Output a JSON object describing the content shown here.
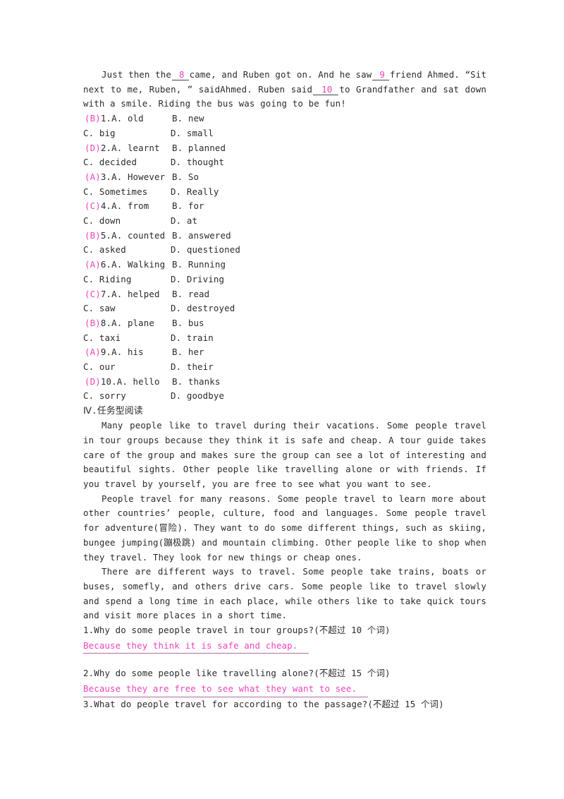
{
  "cloze": {
    "passage_lines": [
      {
        "segments": [
          {
            "type": "text",
            "value": "Just then the "
          },
          {
            "type": "blank",
            "value": "8"
          },
          {
            "type": "text",
            "value": "came, and Ruben got on. And he saw "
          },
          {
            "type": "blank",
            "value": "9"
          },
          {
            "type": "text",
            "value": " friend Ahmed. “Sit next to me, Ruben, ” saidAhmed. Ruben said "
          },
          {
            "type": "blank",
            "value": "10"
          },
          {
            "type": "text",
            "value": " to Grandfather and sat down with a smile. Riding the bus was going to be fun!"
          }
        ]
      }
    ],
    "full_text": "Just then the 8 came, and Ruben got on. And he saw 9 friend Ahmed. “Sit next to me, Ruben, ” saidAhmed. Ruben said 10 to Grandfather and sat down with a smile. Riding the bus was going to be fun!",
    "questions": [
      {
        "key": "B",
        "number": "1.",
        "a": "A. old",
        "b": "B. new",
        "c": "C. big",
        "d": "D. small"
      },
      {
        "key": "D",
        "number": "2.",
        "a": "A. learnt",
        "b": "B. planned",
        "c": "C. decided",
        "d": "D. thought"
      },
      {
        "key": "A",
        "number": "3.",
        "a": "A. However",
        "b": "B. So",
        "c": "C. Sometimes",
        "d": "D. Really"
      },
      {
        "key": "C",
        "number": "4.",
        "a": "A. from",
        "b": "B. for",
        "c": "C. down",
        "d": "D. at"
      },
      {
        "key": "B",
        "number": "5.",
        "a": "A. counted",
        "b": "B. answered",
        "c": "C. asked",
        "d": "D. questioned"
      },
      {
        "key": "A",
        "number": "6.",
        "a": "A. Walking",
        "b": "B. Running",
        "c": "C. Riding",
        "d": "D. Driving"
      },
      {
        "key": "C",
        "number": "7.",
        "a": "A. helped",
        "b": "B. read",
        "c": "C. saw",
        "d": "D. destroyed"
      },
      {
        "key": "B",
        "number": "8.",
        "a": "A. plane",
        "b": "B. bus",
        "c": "C. taxi",
        "d": "D. train"
      },
      {
        "key": "A",
        "number": "9.",
        "a": "A. his",
        "b": "B. her",
        "c": "C. our",
        "d": "D. their"
      },
      {
        "key": "D",
        "number": "10.",
        "a": "A. hello",
        "b": "B. thanks",
        "c": "C. sorry",
        "d": "D. goodbye"
      }
    ]
  },
  "reading": {
    "heading": "Ⅳ.任务型阅读",
    "paragraphs": [
      "Many people like to travel during their vacations. Some people travel in tour groups because they think it is safe and cheap. A tour guide takes care of the group and makes sure the group can see a lot of interesting and beautiful sights. Other people like travelling alone or with friends. If you travel by yourself, you are free to see what you want to see.",
      "People travel for many reasons. Some people travel to learn more about other countries’ people, culture, food and languages. Some people travel for adventure(冒险). They want to do some different things, such as skiing, bungee jumping(蹦极跳) and mountain climbing. Other people like to shop when they travel. They look for new things or cheap ones.",
      "There are different ways to travel. Some people take trains, boats or buses, somefly, and others drive cars. Some people like to travel slowly and spend a long time in each place, while others like to take quick tours and visit more places in a short time."
    ],
    "questions": [
      {
        "number": "1.",
        "text": "Why do some people travel in tour groups?(不超过 10 个词)",
        "answer": "Because they think it is safe and cheap."
      },
      {
        "number": "2.",
        "text": "Why do some people like travelling alone?(不超过 15 个词)",
        "answer": "Because they are free to see what they want to see."
      },
      {
        "number": "3.",
        "text": "What do people travel for according to the passage?(不超过 15 个词)",
        "answer": ""
      }
    ]
  },
  "colors": {
    "answer_pink": "#ee44bb",
    "body_text": "#2b2b2b",
    "underline": "#b06da0"
  }
}
